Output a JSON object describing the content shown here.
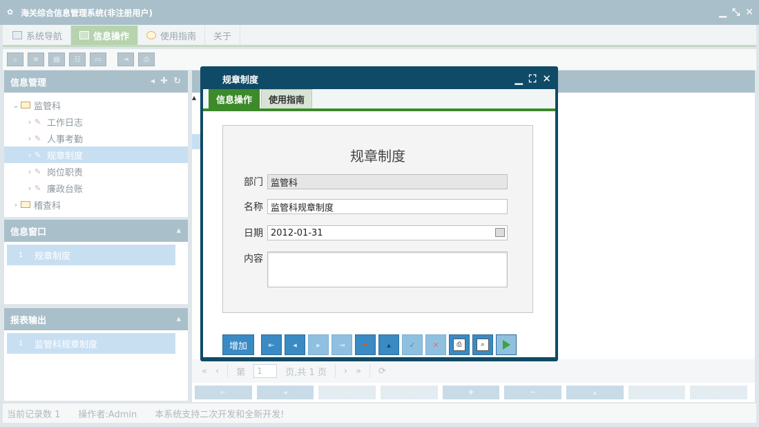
{
  "app": {
    "title": "海关综合信息管理系统(非注册用户)"
  },
  "menu": {
    "tabs": [
      {
        "label": "系统导航"
      },
      {
        "label": "信息操作"
      },
      {
        "label": "使用指南"
      },
      {
        "label": "关于"
      }
    ]
  },
  "sidebar": {
    "info_mgmt": {
      "title": "信息管理"
    },
    "tree": [
      {
        "label": "监管科"
      },
      {
        "label": "工作日志"
      },
      {
        "label": "人事考勤"
      },
      {
        "label": "规章制度"
      },
      {
        "label": "岗位职责"
      },
      {
        "label": "廉政台账"
      },
      {
        "label": "稽查科"
      }
    ],
    "info_window": {
      "title": "信息窗口",
      "items": [
        {
          "num": "1",
          "label": "规章制度"
        }
      ]
    },
    "report": {
      "title": "报表输出",
      "items": [
        {
          "num": "1",
          "label": "监管科规章制度"
        }
      ]
    }
  },
  "pager": {
    "prefix": "第",
    "page": "1",
    "suffix": "页,共 1 页"
  },
  "status": {
    "count": "当前记录数 1",
    "operator": "操作者:Admin",
    "note": "本系统支持二次开发和全新开发!"
  },
  "dialog": {
    "title": "规章制度",
    "tabs": [
      {
        "label": "信息操作"
      },
      {
        "label": "使用指南"
      }
    ],
    "form": {
      "heading": "规章制度",
      "dept": {
        "label": "部门",
        "value": "监管科"
      },
      "name": {
        "label": "名称",
        "value": "监管科规章制度"
      },
      "date": {
        "label": "日期",
        "value": "2012-01-31"
      },
      "content": {
        "label": "内容",
        "value": ""
      }
    },
    "buttons": {
      "add": "增加"
    }
  }
}
